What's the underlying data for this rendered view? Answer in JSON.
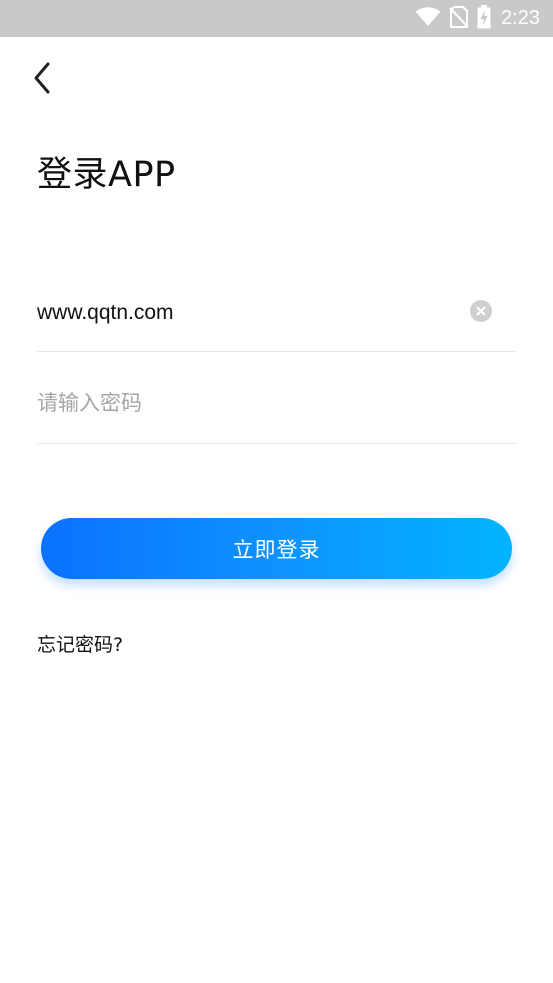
{
  "status_bar": {
    "time": "2:23",
    "icons": [
      "wifi-icon",
      "no-sim-icon",
      "battery-charging-icon"
    ]
  },
  "header": {
    "back_icon": "chevron-left-icon",
    "title": "登录APP"
  },
  "form": {
    "username": {
      "value": "www.qqtn.com",
      "clear_icon": "clear-icon"
    },
    "password": {
      "value": "",
      "placeholder": "请输入密码"
    },
    "login_button": {
      "label": "立即登录",
      "gradient_start": "#0a72ff",
      "gradient_end": "#02b4ff"
    },
    "forgot_password": "忘记密码?"
  },
  "colors": {
    "status_bar_bg": "#c9c9c9",
    "accent": "#0e92ff",
    "divider": "#e6e6e6",
    "placeholder": "#a6a6a6"
  }
}
